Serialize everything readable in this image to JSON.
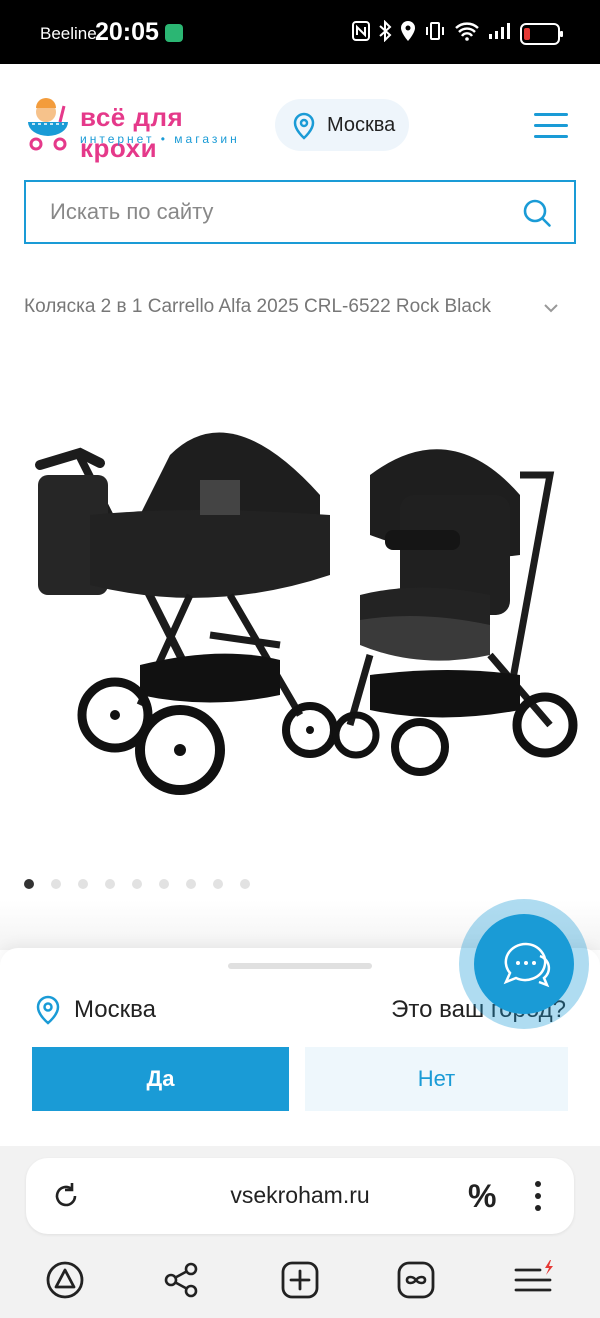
{
  "status_bar": {
    "carrier": "Beeline",
    "time": "20:05",
    "battery_color": "#e53935",
    "icons": [
      "nfc-icon",
      "bluetooth-icon",
      "location-icon",
      "vibrate-icon",
      "wifi-icon",
      "signal-icon",
      "battery-icon"
    ]
  },
  "header": {
    "logo_text": "всё для крохи",
    "logo_tagline": "интернет • магазин",
    "city": "Москва",
    "menu_icon": "hamburger-icon"
  },
  "search": {
    "placeholder": "Искать по сайту",
    "icon": "search-icon"
  },
  "product": {
    "title": "Коляска 2 в 1 Carrello Alfa 2025 CRL-6522 Rock Black",
    "gallery_total": 9,
    "gallery_active": 1
  },
  "city_prompt": {
    "city": "Москва",
    "question": "Это ваш город?",
    "yes_label": "Да",
    "no_label": "Нет"
  },
  "browser": {
    "url": "vsekroham.ru",
    "percent_label": "%"
  },
  "colors": {
    "accent": "#1a9bd6",
    "brand_pink": "#e5398a",
    "light_blue": "#eef7fc"
  }
}
